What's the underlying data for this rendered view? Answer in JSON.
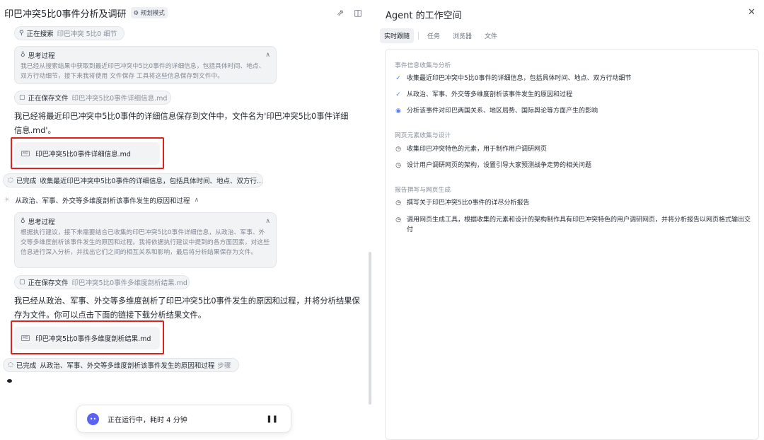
{
  "header": {
    "title": "印巴冲突5比0事件分析及调研",
    "mode_badge": "规划模式"
  },
  "chat": {
    "search_pill": {
      "label": "正在搜索",
      "sub": "印巴冲突 5比0 细节"
    },
    "think1": {
      "title": "思考过程",
      "body": "我已经从搜索结果中获取到最近印巴冲突中5比0事件的详细信息，包括具体时间、地点、双方行动细节，接下来我将使用 文件保存 工具将这些信息保存到文件中。"
    },
    "save_pill1": {
      "label": "正在保存文件",
      "sub": "印巴冲突5比0事件详细信息.md"
    },
    "msg1": "我已经将最近印巴冲突中5比0事件的详细信息保存到文件中，文件名为'印巴冲突5比0事件详细信息.md'。",
    "file1": "印巴冲突5比0事件详细信息.md",
    "done_pill1": {
      "label": "已完成",
      "sub": "收集最近印巴冲突中5比0事件的详细信息，包括具体时间、地点、双方行..."
    },
    "step2": "从政治、军事、外交等多维度剖析该事件发生的原因和过程",
    "think2": {
      "title": "思考过程",
      "body": "根据执行建议，接下来需要结合已收集的印巴冲突5比0事件详细信息，从政治、军事、外交等多维度剖析该事件发生的原因和过程。我将依据执行建议中提到的各方面因素，对这些信息进行深入分析，并找出它们之间的相互关系和影响，最后将分析结果保存为文件。"
    },
    "save_pill2": {
      "label": "正在保存文件",
      "sub": "印巴冲突5比0事件多维度剖析结果.md"
    },
    "msg2": "我已经从政治、军事、外交等多维度剖析了印巴冲突5比0事件发生的原因和过程，并将分析结果保存为文件。你可以点击下面的链接下载分析结果文件。",
    "file2": "印巴冲突5比0事件多维度剖析结果.md",
    "done_pill2": {
      "label": "已完成",
      "sub": "从政治、军事、外交等多维度剖析该事件发生的原因和过程",
      "extra": "步骤"
    },
    "running": "正在运行中，耗时 4 分钟"
  },
  "workspace": {
    "title": "Agent 的工作空间",
    "tabs": [
      "实时跟随",
      "任务",
      "浏览器",
      "文件"
    ],
    "sections": [
      {
        "title": "事件信息收集与分析",
        "items": [
          {
            "status": "done",
            "text": "收集最近印巴冲突中5比0事件的详细信息，包括具体时间、地点、双方行动细节"
          },
          {
            "status": "done",
            "text": "从政治、军事、外交等多维度剖析该事件发生的原因和过程"
          },
          {
            "status": "active",
            "text": "分析该事件对印巴两国关系、地区局势、国际舆论等方面产生的影响"
          }
        ]
      },
      {
        "title": "网页元素收集与设计",
        "items": [
          {
            "status": "pending",
            "text": "收集印巴冲突特色的元素，用于制作用户调研网页"
          },
          {
            "status": "pending",
            "text": "设计用户调研网页的架构，设置引导大家预测战争走势的相关问题"
          }
        ]
      },
      {
        "title": "报告撰写与网页生成",
        "items": [
          {
            "status": "pending",
            "text": "撰写关于印巴冲突5比0事件的详尽分析报告"
          },
          {
            "status": "pending",
            "text": "调用网页生成工具，根据收集的元素和设计的架构制作具有印巴冲突特色的用户调研网页，并将分析报告以网页格式输出交付"
          }
        ]
      }
    ]
  },
  "colors": {
    "accent": "#4c7cf6",
    "highlight": "#e0201c",
    "bot": "#5b63f2"
  }
}
